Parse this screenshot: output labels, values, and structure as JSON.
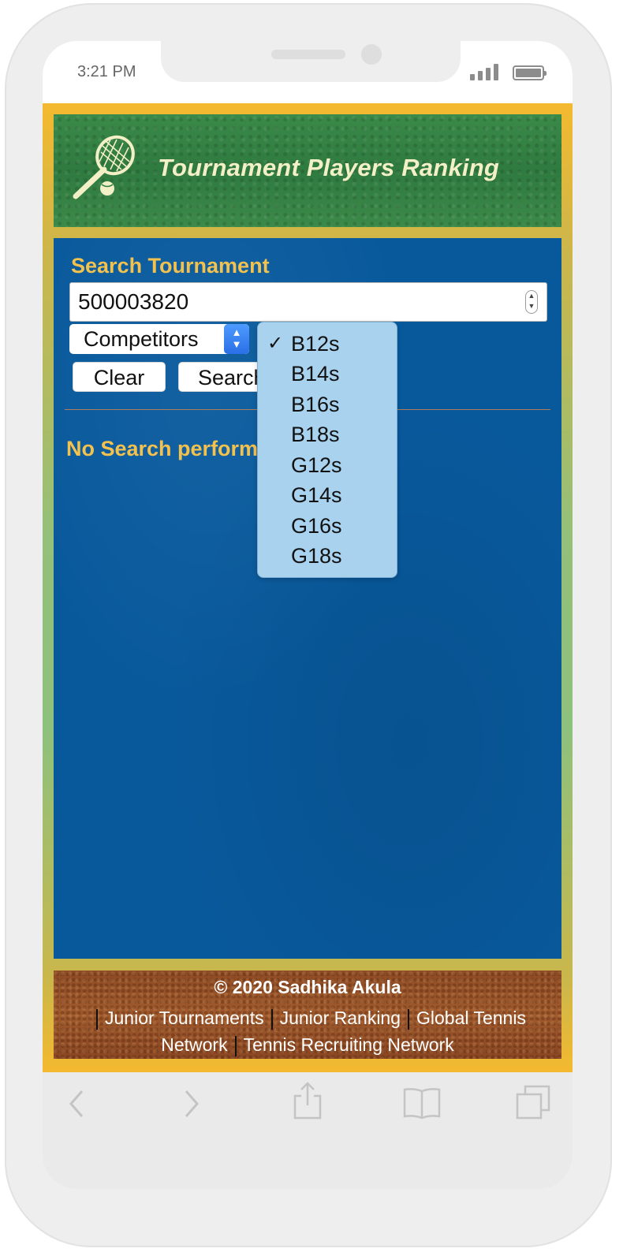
{
  "status_bar": {
    "time": "3:21 PM"
  },
  "header": {
    "title": "Tournament Players Ranking"
  },
  "search": {
    "label": "Search Tournament",
    "tournament_value": "500003820",
    "select_value": "Competitors",
    "clear_label": "Clear",
    "search_label": "Search"
  },
  "results": {
    "message": "No Search performed"
  },
  "dropdown": {
    "checkmark": "✓",
    "selected": "B12s",
    "options": [
      "B12s",
      "B14s",
      "B16s",
      "B18s",
      "G12s",
      "G14s",
      "G16s",
      "G18s"
    ]
  },
  "footer": {
    "copyright": "© 2020 Sadhika Akula",
    "links": [
      "Junior Tournaments",
      "Junior Ranking",
      "Global Tennis",
      "Network",
      "Tennis Recruiting Network"
    ]
  },
  "colors": {
    "frame_gold": "#f4b92f",
    "label_yellow": "#f2c14e",
    "main_blue": "#08599c",
    "grass_green": "#2f7a3f",
    "clay_brown": "#9a5429",
    "dropdown_blue": "#a9d2ef"
  },
  "icons": {
    "logo": "tennis-racket-ball-icon",
    "browser_bar": [
      "back-icon",
      "forward-icon",
      "share-icon",
      "bookmarks-icon",
      "tabs-icon"
    ]
  }
}
